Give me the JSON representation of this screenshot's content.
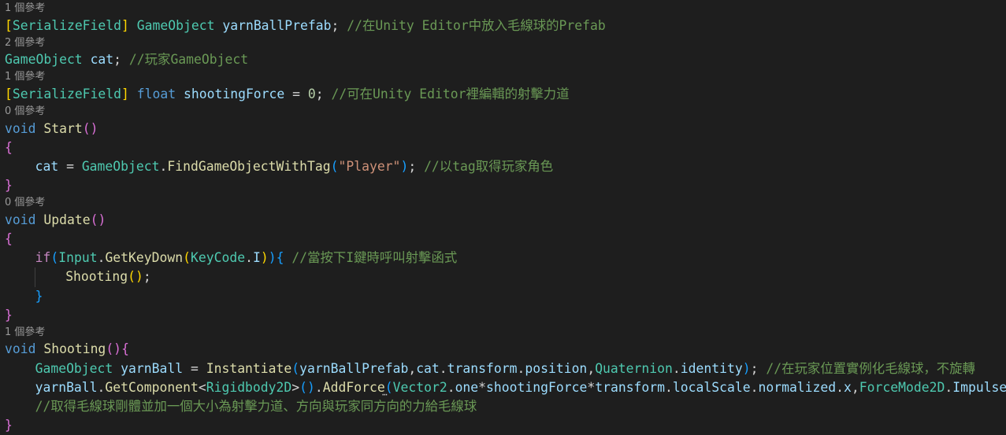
{
  "codelens": {
    "yarnBallPrefab_refs": "1 個參考",
    "cat_refs": "2 個參考",
    "shootingForce_refs": "1 個參考",
    "start_refs": "0 個參考",
    "update_refs": "0 個參考",
    "shooting_refs": "1 個參考"
  },
  "code": {
    "attr_serialize": "SerializeField",
    "type_gameobject": "GameObject",
    "var_yarnBallPrefab": "yarnBallPrefab",
    "comment_prefab": "//在Unity Editor中放入毛線球的Prefab",
    "var_cat": "cat",
    "comment_player": "//玩家GameObject",
    "kw_float": "float",
    "var_shootingForce": "shootingForce",
    "num_zero": "0",
    "comment_force": "//可在Unity Editor裡編輯的射擊力道",
    "kw_void": "void",
    "fn_start": "Start",
    "fn_find": "FindGameObjectWithTag",
    "str_player": "\"Player\"",
    "comment_tag": "//以tag取得玩家角色",
    "fn_update": "Update",
    "kw_if": "if",
    "ty_input": "Input",
    "fn_getkeydown": "GetKeyDown",
    "ty_keycode": "KeyCode",
    "var_I": "I",
    "comment_key": "//當按下I鍵時呼叫射擊函式",
    "fn_shooting": "Shooting",
    "var_yarnBall": "yarnBall",
    "fn_instantiate": "Instantiate",
    "var_transform": "transform",
    "var_position": "position",
    "ty_quaternion": "Quaternion",
    "var_identity": "identity",
    "comment_instantiate": "//在玩家位置實例化毛線球，不旋轉",
    "fn_getcomponent": "GetComponent",
    "ty_rigidbody": "Rigidbody2D",
    "fn_addforce": "AddForce",
    "ty_vector2": "Vector2",
    "var_one": "one",
    "var_localScale": "localScale",
    "var_normalized": "normalized",
    "var_x": "x",
    "ty_forcemode": "ForceMode2D",
    "var_impulse": "Impulse",
    "comment_rigidbody": "//取得毛線球剛體並加一個大小為射擊力道、方向與玩家同方向的力給毛線球"
  },
  "colors": {
    "background": "#1e1e1e",
    "keyword": "#569cd6",
    "type": "#4ec9b0",
    "function": "#dcdcaa",
    "variable": "#9cdcfe",
    "string": "#ce9178",
    "number": "#b5cea8",
    "comment": "#6a9955",
    "codelens": "#999999"
  }
}
